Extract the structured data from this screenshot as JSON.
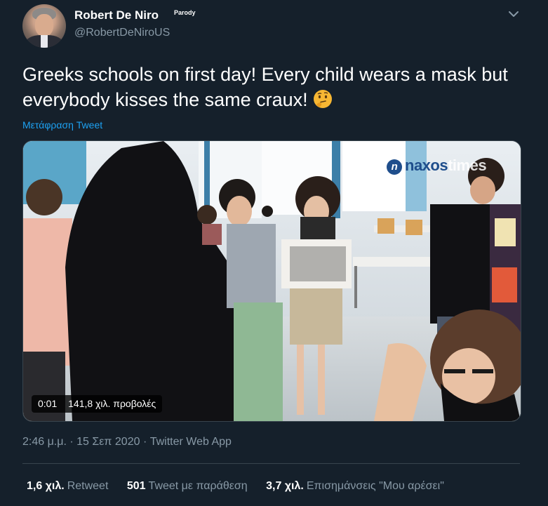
{
  "author": {
    "display_name": "Robert De Niro",
    "badge": "Parody",
    "handle": "@RobertDeNiroUS"
  },
  "tweet": {
    "text": "Greeks schools on first day! Every child wears a mask but everybody kisses the same craux!",
    "emoji": "thinking-face-icon",
    "translate_label": "Μετάφραση Tweet"
  },
  "media": {
    "watermark_brand": "naxos",
    "watermark_faded": "times",
    "video_time": "0:01",
    "video_views": "141,8 χιλ. προβολές"
  },
  "meta": {
    "time": "2:46 μ.μ.",
    "separator": "·",
    "date": "15 Σεπ 2020",
    "source": "Twitter Web App"
  },
  "stats": {
    "retweets_count": "1,6 χιλ.",
    "retweets_label": "Retweet",
    "quotes_count": "501",
    "quotes_label": "Tweet με παράθεση",
    "likes_count": "3,7 χιλ.",
    "likes_label": "Επισημάνσεις \"Μου αρέσει\""
  },
  "colors": {
    "background": "#15202b",
    "secondary_text": "#8899a6",
    "link": "#1da1f2",
    "border": "#38444d"
  }
}
